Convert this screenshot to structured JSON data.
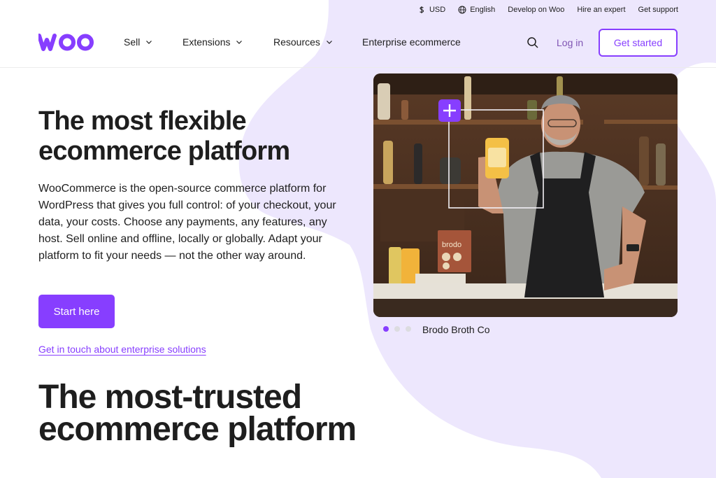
{
  "colors": {
    "brand": "#873eff",
    "brand_dark": "#7f54b3",
    "blob": "#ede7fd",
    "text": "#1e1e1e"
  },
  "utility_bar": {
    "currency": "USD",
    "language": "English",
    "develop": "Develop on Woo",
    "hire": "Hire an expert",
    "support": "Get support"
  },
  "nav": {
    "logo": "woo",
    "items": [
      {
        "label": "Sell",
        "has_dropdown": true
      },
      {
        "label": "Extensions",
        "has_dropdown": true
      },
      {
        "label": "Resources",
        "has_dropdown": true
      },
      {
        "label": "Enterprise ecommerce",
        "has_dropdown": false
      }
    ],
    "search_icon": "search-icon",
    "login": "Log in",
    "get_started": "Get started"
  },
  "hero": {
    "title_line1": "The most flexible",
    "title_line2": "ecommerce platform",
    "description": "WooCommerce is the open-source commerce platform for WordPress that gives you full control: of your checkout, your data, your costs. Choose any payments, any features, any host. Sell online and offline, locally or globally. Adapt your platform to fit your needs — not the other way around.",
    "cta_primary": "Start here",
    "cta_link": "Get in touch about enterprise solutions",
    "carousel": {
      "caption": "Brodo Broth Co",
      "active_index": 0,
      "count": 3,
      "product_label": "brodo"
    }
  },
  "trusted": {
    "title_line1": "The most-trusted",
    "title_line2": "ecommerce platform"
  }
}
